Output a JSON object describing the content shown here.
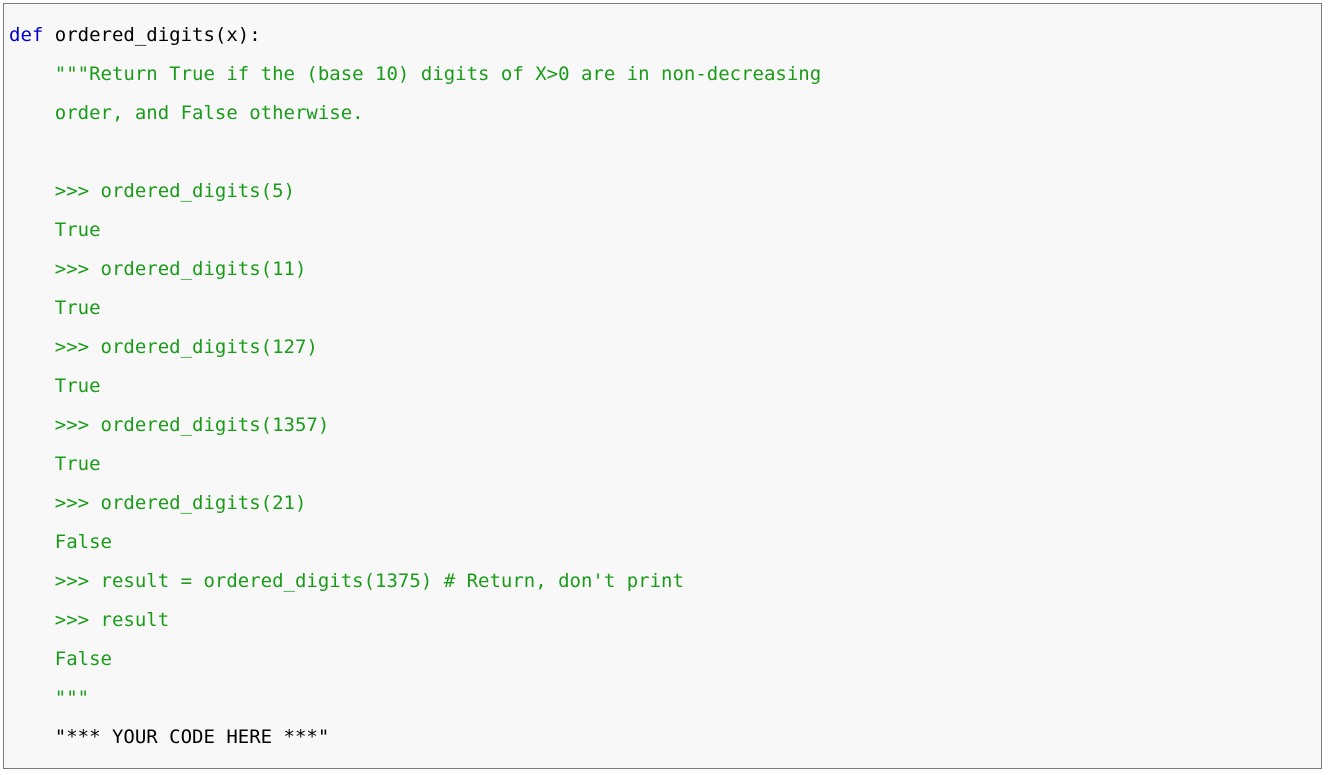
{
  "code": {
    "def_keyword": "def",
    "signature": " ordered_digits(x):",
    "indent": "    ",
    "docstring_lines": [
      "\"\"\"Return True if the (base 10) digits of X>0 are in non-decreasing",
      "order, and False otherwise.",
      "",
      ">>> ordered_digits(5)",
      "True",
      ">>> ordered_digits(11)",
      "True",
      ">>> ordered_digits(127)",
      "True",
      ">>> ordered_digits(1357)",
      "True",
      ">>> ordered_digits(21)",
      "False",
      ">>> result = ordered_digits(1375) # Return, don't print",
      ">>> result",
      "False",
      "\"\"\""
    ],
    "body_line": "\"*** YOUR CODE HERE ***\""
  },
  "colors": {
    "keyword": "#0000cc",
    "docstring": "#1a9c1a",
    "text": "#000000",
    "background": "#f8f8f8",
    "border": "#7a7a7a"
  }
}
